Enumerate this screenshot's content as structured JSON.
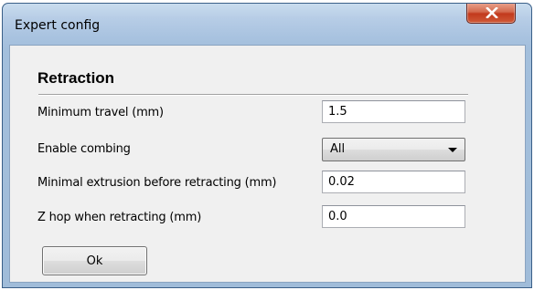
{
  "window": {
    "title": "Expert config",
    "close_icon": "close-icon"
  },
  "section": {
    "title": "Retraction"
  },
  "fields": [
    {
      "label": "Minimum travel (mm)",
      "value": "1.5"
    },
    {
      "label": "Enable combing",
      "value": "All",
      "icon": "chevron-down-icon"
    },
    {
      "label": "Minimal extrusion before retracting (mm)",
      "value": "0.02"
    },
    {
      "label": "Z hop when retracting (mm)",
      "value": "0.0"
    }
  ],
  "buttons": {
    "ok_label": "Ok"
  },
  "colors": {
    "titlebar": "#b7cde6",
    "close_button": "#c2391d",
    "client_background": "#f0f0f0"
  }
}
